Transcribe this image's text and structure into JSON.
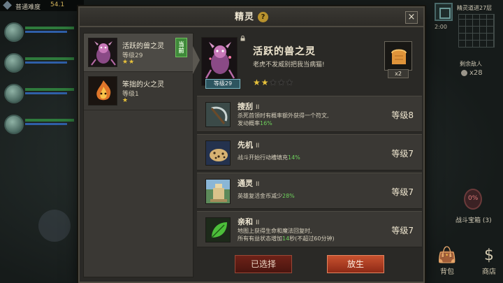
{
  "hud": {
    "difficulty": "普通难度",
    "gold": "54.1",
    "floor_progress": "精灵道进27层",
    "timer": "2:00",
    "kills_label": "剩余敌人",
    "kills_value": "x28",
    "chest_count": "0%",
    "chest_label": "战斗宝箱 (3)",
    "bag_label": "背包",
    "shop_label": "商店"
  },
  "modal": {
    "title": "精灵",
    "help": "?",
    "close": "×"
  },
  "spirits": [
    {
      "name": "活跃的兽之灵",
      "level": "等级29",
      "stars": "★★",
      "equipped": "当前"
    },
    {
      "name": "笨拙的火之灵",
      "level": "等级1",
      "stars": "★"
    }
  ],
  "detail": {
    "name": "活跃的兽之灵",
    "desc": "老虎不发威别把我当病猫!",
    "level_badge": "等级29",
    "stars_on": "★★",
    "stars_off": "★★★",
    "item_count": "x2"
  },
  "skills": [
    {
      "name": "搜刮",
      "rank": "II",
      "desc_pre": "杀死首领时有概率额外获得一个符文,",
      "desc_line2_pre": "发动概率",
      "value": "16%",
      "desc_post": "",
      "level": "等级8",
      "icon": "scythe-icon"
    },
    {
      "name": "先机",
      "rank": "II",
      "desc_pre": "",
      "desc_line2_pre": "战斗开始行动槽填充",
      "value": "14%",
      "desc_post": "",
      "level": "等级7",
      "icon": "leopard-icon"
    },
    {
      "name": "通灵",
      "rank": "II",
      "desc_pre": "",
      "desc_line2_pre": "英雄复活金币减少",
      "value": "28%",
      "desc_post": "",
      "level": "等级7",
      "icon": "altar-icon"
    },
    {
      "name": "亲和",
      "rank": "II",
      "desc_pre": "地图上获得生命和魔法回复时,",
      "desc_line2_pre": "所有有益状态增加",
      "value": "14",
      "desc_post": "秒(不超过60分钟)",
      "level": "等级7",
      "icon": "leaf-icon"
    }
  ],
  "buttons": {
    "selected": "已选择",
    "release": "放生"
  },
  "colors": {
    "accent_gold": "#e8c23b",
    "highlight_green": "#6ed15c",
    "button_red": "#c8512f"
  }
}
